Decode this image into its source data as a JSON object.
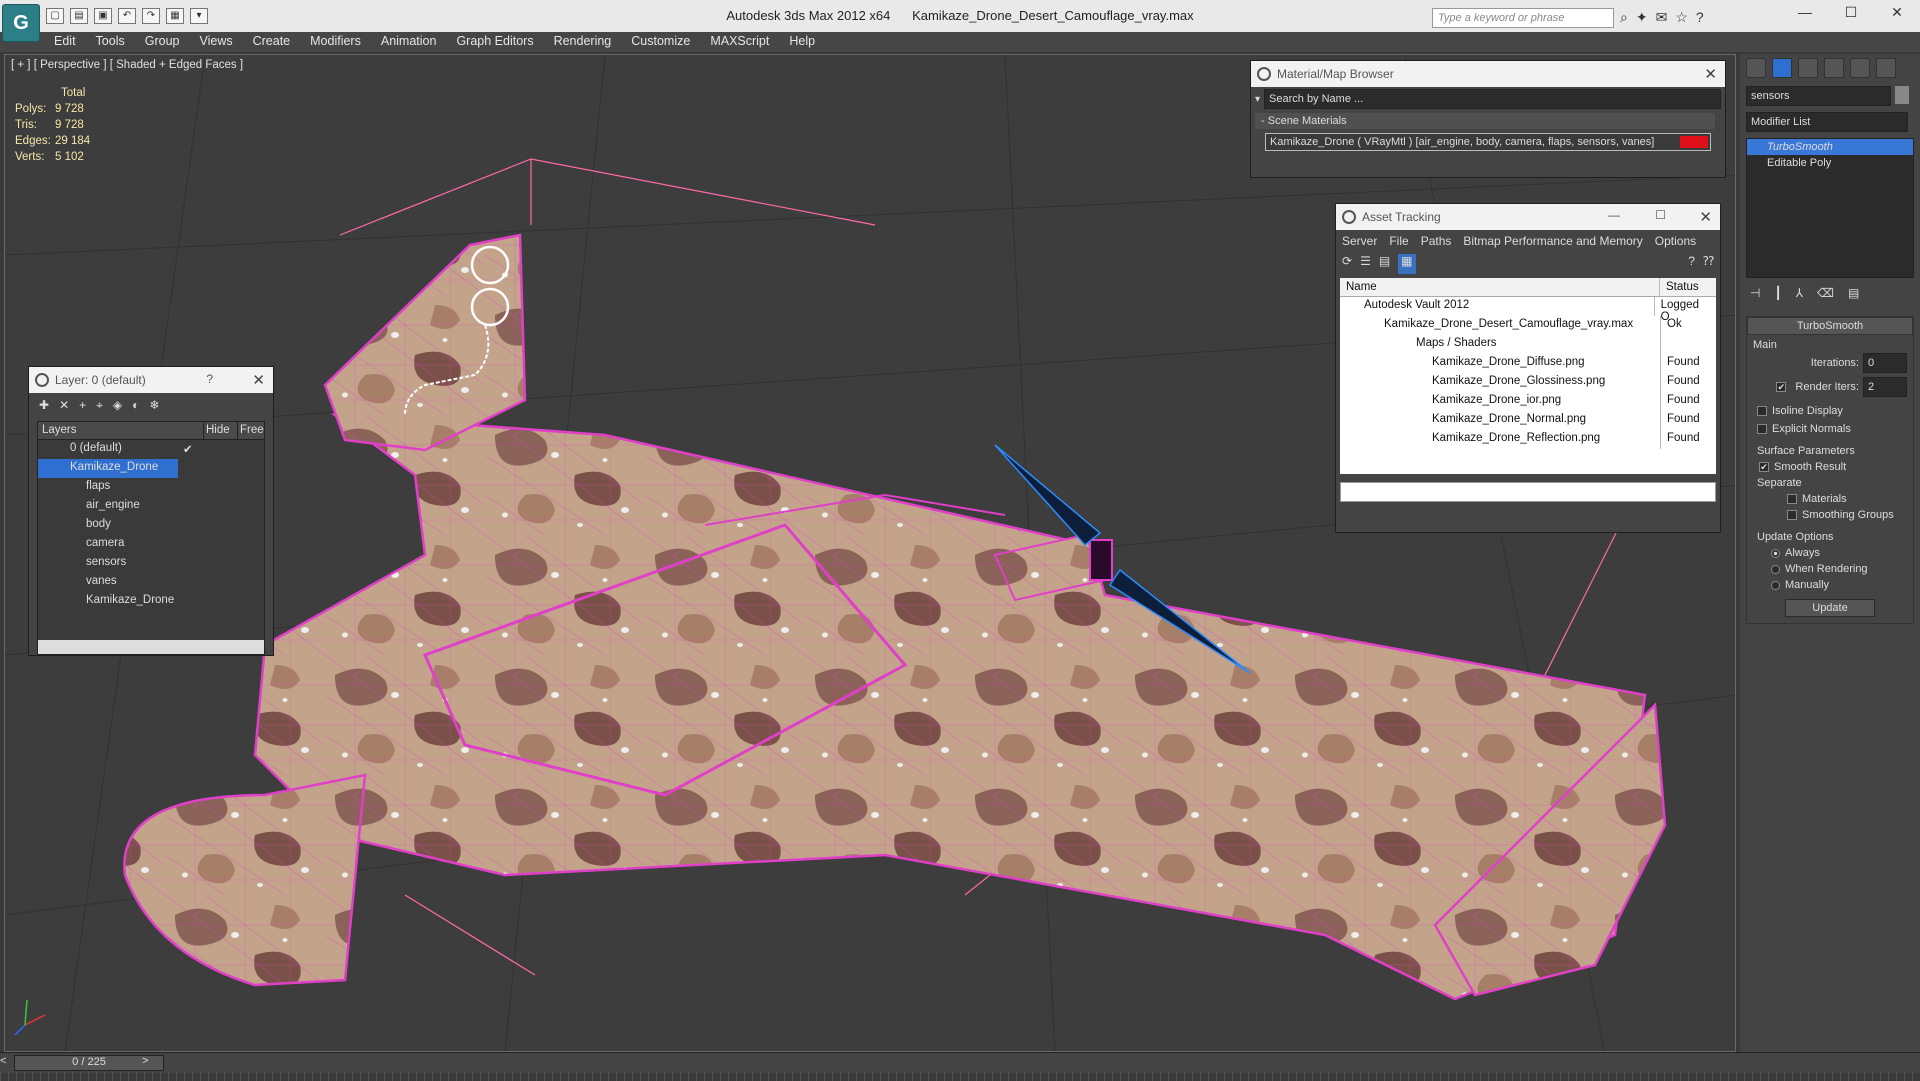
{
  "app": {
    "title": "Autodesk 3ds Max  2012 x64",
    "filename": "Kamikaze_Drone_Desert_Camouflage_vray.max",
    "logo_glyph": "G",
    "search_placeholder": "Type a keyword or phrase"
  },
  "menu": [
    "Edit",
    "Tools",
    "Group",
    "Views",
    "Create",
    "Modifiers",
    "Animation",
    "Graph Editors",
    "Rendering",
    "Customize",
    "MAXScript",
    "Help"
  ],
  "viewport": {
    "label": "[ + ] [ Perspective ] [ Shaded + Edged Faces ]",
    "stats": {
      "header": "Total",
      "rows": [
        {
          "k": "Polys:",
          "v": "9 728"
        },
        {
          "k": "Tris:",
          "v": "9 728"
        },
        {
          "k": "Edges:",
          "v": "29 184"
        },
        {
          "k": "Verts:",
          "v": "5 102"
        }
      ]
    }
  },
  "material_browser": {
    "title": "Material/Map Browser",
    "search": "Search by Name ...",
    "section": "Scene Materials",
    "item": "Kamikaze_Drone  ( VRayMtl ) [air_engine, body, camera, flaps, sensors, vanes]"
  },
  "asset_tracking": {
    "title": "Asset Tracking",
    "menu": [
      "Server",
      "File",
      "Paths",
      "Bitmap Performance and Memory",
      "Options"
    ],
    "col_name": "Name",
    "col_status": "Status",
    "rows": [
      {
        "name": "Autodesk Vault 2012",
        "status": "Logged O"
      },
      {
        "name": "Kamikaze_Drone_Desert_Camouflage_vray.max",
        "status": "Ok"
      },
      {
        "name": "Maps / Shaders",
        "status": ""
      },
      {
        "name": "Kamikaze_Drone_Diffuse.png",
        "status": "Found"
      },
      {
        "name": "Kamikaze_Drone_Glossiness.png",
        "status": "Found"
      },
      {
        "name": "Kamikaze_Drone_ior.png",
        "status": "Found"
      },
      {
        "name": "Kamikaze_Drone_Normal.png",
        "status": "Found"
      },
      {
        "name": "Kamikaze_Drone_Reflection.png",
        "status": "Found"
      }
    ]
  },
  "layers": {
    "title": "Layer: 0 (default)",
    "help": "?",
    "col_layers": "Layers",
    "col_hide": "Hide",
    "col_freeze": "Freeze",
    "rows": [
      {
        "name": "0 (default)"
      },
      {
        "name": "Kamikaze_Drone"
      },
      {
        "name": "flaps"
      },
      {
        "name": "air_engine"
      },
      {
        "name": "body"
      },
      {
        "name": "camera"
      },
      {
        "name": "sensors"
      },
      {
        "name": "vanes"
      },
      {
        "name": "Kamikaze_Drone"
      }
    ]
  },
  "command_panel": {
    "object_name": "sensors",
    "modifier_list": "Modifier List",
    "stack": [
      "TurboSmooth",
      "Editable Poly"
    ],
    "rollout": "TurboSmooth",
    "main": "Main",
    "iterations_label": "Iterations:",
    "iterations": "0",
    "render_iters_label": "Render Iters:",
    "render_iters": "2",
    "isoline": "Isoline Display",
    "explicit": "Explicit Normals",
    "surface": "Surface Parameters",
    "smooth_result": "Smooth Result",
    "separate": "Separate",
    "materials": "Materials",
    "smoothing_groups": "Smoothing Groups",
    "update_options": "Update Options",
    "always": "Always",
    "when_rendering": "When Rendering",
    "manually": "Manually",
    "update": "Update"
  },
  "timeline": {
    "frame": "0 / 225"
  },
  "colors": {
    "wire": "#e040c8",
    "camo_light": "#c9a78e",
    "camo_dark": "#7a5148",
    "prop": "#2a8cff"
  }
}
